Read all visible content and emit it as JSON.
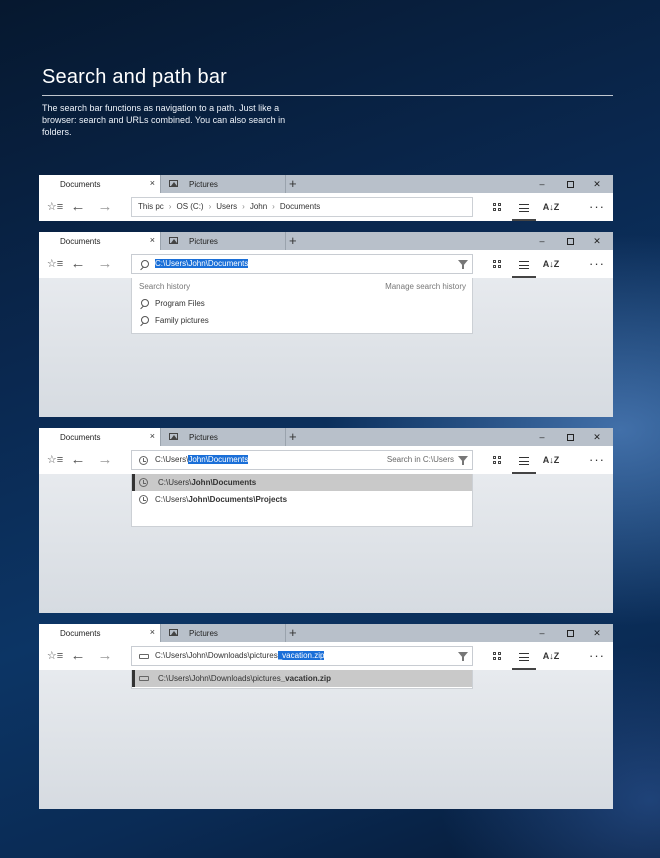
{
  "hero": {
    "title": "Search and path bar",
    "description": "The search bar functions as navigation to a path. Just like a browser: search and URLs combined. You can also search in folders."
  },
  "tabs": {
    "active": "Documents",
    "inactive": "Pictures",
    "new_tab": "+",
    "close": "×"
  },
  "window_controls": {
    "minimize": "–",
    "close": "✕"
  },
  "toolbar": {
    "favorites_icon": "☆≡",
    "back": "←",
    "forward": "→",
    "sort_icon": "A↓Z",
    "more": "···"
  },
  "breadcrumb": [
    "This pc",
    "OS (C:)",
    "Users",
    "John",
    "Documents"
  ],
  "breadcrumb_separator": "›",
  "search_history_panel": {
    "query": "C:\\Users\\John\\Documents",
    "history_label": "Search history",
    "manage_label": "Manage search history",
    "items": [
      "Program Files",
      "Family pictures"
    ]
  },
  "path_complete_panel": {
    "prefix": "C:\\Users\\",
    "selected": "John\\Documents",
    "hint": "Search in C:\\Users",
    "suggestions": [
      {
        "prefix": "C:\\Users\\",
        "bold": "John\\Documents"
      },
      {
        "prefix": "C:\\Users\\",
        "bold": "John\\Documents\\Projects"
      }
    ]
  },
  "file_complete_panel": {
    "prefix": "C:\\Users\\John\\Downloads\\pictures",
    "selected": "_vacation.zip",
    "suggestion": {
      "prefix": "C:\\Users\\John\\Downloads\\pictures",
      "bold": "_vacation.zip"
    }
  },
  "colors": {
    "selection": "#1a6fd8",
    "tabbar": "#b8c0ca",
    "highlight_row": "#c9c9c9"
  }
}
